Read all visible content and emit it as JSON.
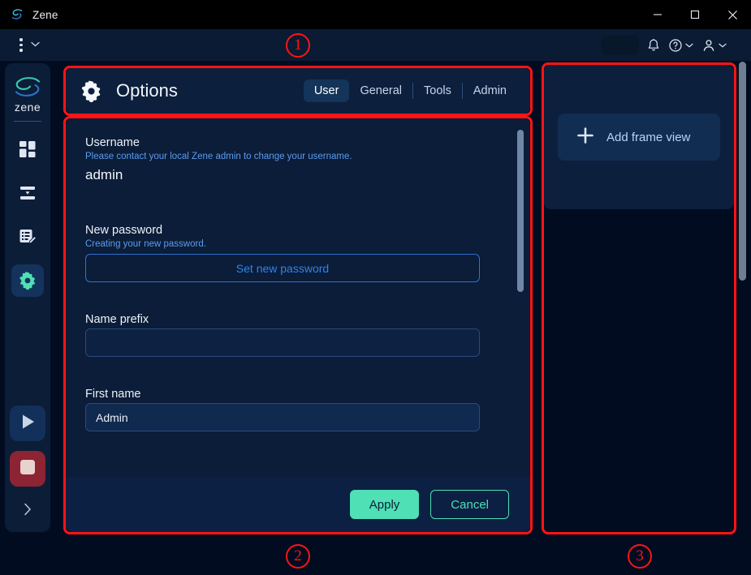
{
  "window": {
    "app_logo_icon": "zene-swirl-icon",
    "title": "Zene",
    "minimize_icon": "minimize-icon",
    "maximize_icon": "maximize-icon",
    "close_icon": "close-icon"
  },
  "toolbar": {
    "kebab_icon": "kebab-menu-icon",
    "kebab_chevron_icon": "chevron-down-icon",
    "search_pill": "",
    "bell_icon": "bell-icon",
    "help_icon": "help-circle-icon",
    "help_chevron_icon": "chevron-down-icon",
    "user_icon": "user-avatar-icon",
    "user_chevron_icon": "chevron-down-icon"
  },
  "sidebar": {
    "brand": "zene",
    "logo_icon": "zene-swirl-icon",
    "items": [
      {
        "name": "dashboard",
        "icon": "grid-squares-icon",
        "active": false
      },
      {
        "name": "collapse",
        "icon": "align-collapse-icon",
        "active": false
      },
      {
        "name": "reports",
        "icon": "list-edit-icon",
        "active": false
      },
      {
        "name": "options",
        "icon": "gear-icon",
        "active": true
      }
    ],
    "play_icon": "play-icon",
    "stop_icon": "stop-icon",
    "expand_icon": "chevron-right-icon"
  },
  "options": {
    "gear_icon": "gear-icon",
    "title": "Options",
    "tabs": [
      {
        "label": "User",
        "active": true
      },
      {
        "label": "General",
        "active": false
      },
      {
        "label": "Tools",
        "active": false
      },
      {
        "label": "Admin",
        "active": false
      }
    ],
    "fields": {
      "username_label": "Username",
      "username_hint": "Please contact your local Zene admin to change your username.",
      "username_value": "admin",
      "new_password_label": "New password",
      "new_password_hint": "Creating your new password.",
      "set_password_button": "Set new password",
      "name_prefix_label": "Name prefix",
      "name_prefix_value": "",
      "name_prefix_placeholder": "",
      "first_name_label": "First name",
      "first_name_value": "Admin",
      "first_name_placeholder": ""
    },
    "footer": {
      "apply": "Apply",
      "cancel": "Cancel"
    }
  },
  "right_panel": {
    "add_frame_icon": "plus-icon",
    "add_frame_label": "Add frame view"
  },
  "annotations": [
    {
      "id": "1",
      "label": "1"
    },
    {
      "id": "2",
      "label": "2"
    },
    {
      "id": "3",
      "label": "3"
    }
  ],
  "colors": {
    "accent_teal": "#4fe0b5",
    "accent_blue": "#2f83f0",
    "panel_bg": "#0c1f3d",
    "app_bg": "#010c20",
    "annotation_red": "#ff1414"
  }
}
